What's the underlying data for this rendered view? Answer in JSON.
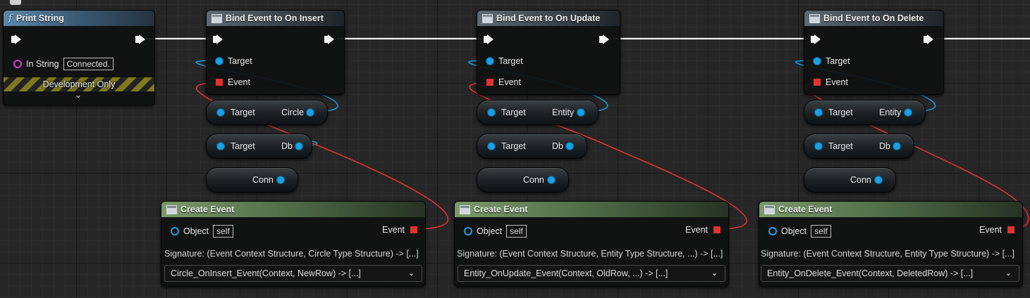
{
  "print_string": {
    "title": "Print String",
    "in_string_label": "In String",
    "in_string_value": "Connected.",
    "dev_only": "Development Only",
    "expand_glyph": "⌄"
  },
  "bind_nodes": [
    {
      "title": "Bind Event to On Insert",
      "target_label": "Target",
      "event_label": "Event"
    },
    {
      "title": "Bind Event to On Update",
      "target_label": "Target",
      "event_label": "Event"
    },
    {
      "title": "Bind Event to On Delete",
      "target_label": "Target",
      "event_label": "Event"
    }
  ],
  "getter_nodes": [
    {
      "target": "Target",
      "output": "Circle"
    },
    {
      "target": "Target",
      "output": "Db"
    },
    {
      "output": "Conn"
    },
    {
      "target": "Target",
      "output": "Entity"
    },
    {
      "target": "Target",
      "output": "Db"
    },
    {
      "output": "Conn"
    },
    {
      "target": "Target",
      "output": "Entity"
    },
    {
      "target": "Target",
      "output": "Db"
    },
    {
      "output": "Conn"
    }
  ],
  "create_nodes": [
    {
      "title": "Create Event",
      "object_label": "Object",
      "object_value": "self",
      "event_label": "Event",
      "signature": "Signature: (Event Context Structure, Circle Type Structure) -> [...]",
      "function": "Circle_OnInsert_Event(Context, NewRow) -> [...]"
    },
    {
      "title": "Create Event",
      "object_label": "Object",
      "object_value": "self",
      "event_label": "Event",
      "signature": "Signature: (Event Context Structure, Entity Type Structure, ...) -> [...]",
      "function": "Entity_OnUpdate_Event(Context, OldRow, ...) -> [...]"
    },
    {
      "title": "Create Event",
      "object_label": "Object",
      "object_value": "self",
      "event_label": "Event",
      "signature": "Signature: (Event Context Structure, Entity Type Structure) -> [...]",
      "function": "Entity_OnDelete_Event(Context, DeletedRow) -> [...]"
    }
  ],
  "colors": {
    "exec_wire": "#f4f4f4",
    "object_wire": "#1aa0e4",
    "delegate_wire": "#e23333",
    "background": "#262626"
  },
  "icons": {
    "function": "function-icon",
    "node": "node-icon",
    "comment": "comment-bubble-icon",
    "dropdown": "chevron-down-icon"
  }
}
